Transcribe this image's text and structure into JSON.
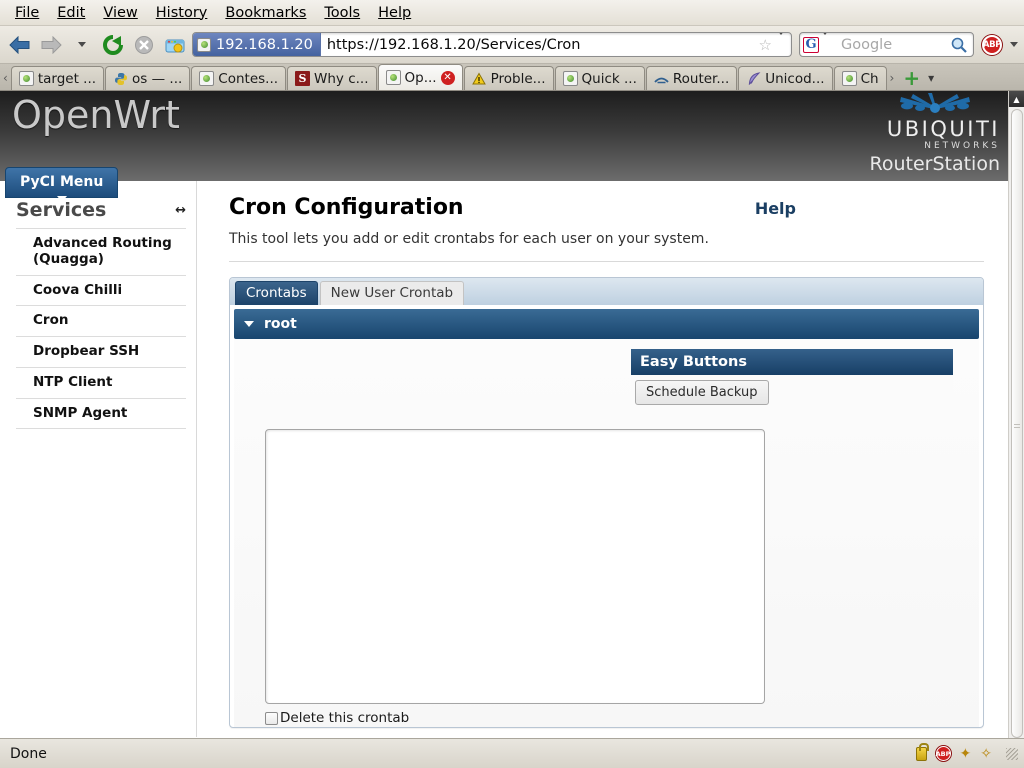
{
  "browser": {
    "menus": [
      "File",
      "Edit",
      "View",
      "History",
      "Bookmarks",
      "Tools",
      "Help"
    ],
    "nav": {
      "back_icon": "back-arrow-icon",
      "forward_icon": "forward-arrow-icon",
      "history_caret_icon": "chevron-down-icon",
      "reload_icon": "reload-icon",
      "stop_icon": "stop-icon",
      "home_icon": "home-icon"
    },
    "address": {
      "identity_label": "192.168.1.20",
      "url": "https://192.168.1.20/Services/Cron",
      "star_icon": "bookmark-star-icon",
      "dropdown_icon": "chevron-down-icon"
    },
    "search": {
      "engine": "G",
      "placeholder": "Google",
      "search_icon": "magnifier-icon"
    },
    "adblock_label": "ABP",
    "tabs": [
      {
        "label": "target ...",
        "icon": "page-icon",
        "active": false
      },
      {
        "label": "os — ...",
        "icon": "python-icon",
        "active": false
      },
      {
        "label": "Contes...",
        "icon": "page-icon",
        "active": false
      },
      {
        "label": "Why c...",
        "icon": "stackoverflow-icon",
        "active": false
      },
      {
        "label": "Op...",
        "icon": "page-icon",
        "active": true
      },
      {
        "label": "Proble...",
        "icon": "warning-icon",
        "active": false
      },
      {
        "label": "Quick ...",
        "icon": "page-icon",
        "active": false
      },
      {
        "label": "Router...",
        "icon": "router-icon",
        "active": false
      },
      {
        "label": "Unicod...",
        "icon": "feather-icon",
        "active": false
      },
      {
        "label": "Ch",
        "icon": "page-icon",
        "active": false
      }
    ],
    "tab_scroll_left_icon": "chevron-left-icon",
    "tab_scroll_right_icon": "chevron-right-icon",
    "new_tab_label": "+",
    "list_tabs_icon": "chevron-down-icon",
    "status": {
      "text": "Done",
      "icons": [
        "lock-icon",
        "adblock-icon",
        "noscript-icon",
        "addon-icon"
      ]
    }
  },
  "page": {
    "brand": "OpenWrt",
    "vendor": {
      "name": "UBIQUITI",
      "sub": "NETWORKS",
      "product": "RouterStation"
    },
    "menu_button": "PyCI Menu",
    "sidebar": {
      "title": "Services",
      "collapse_icon": "collapse-arrows-icon",
      "items": [
        {
          "label": "Advanced Routing (Quagga)"
        },
        {
          "label": "Coova Chilli"
        },
        {
          "label": "Cron"
        },
        {
          "label": "Dropbear SSH"
        },
        {
          "label": "NTP Client"
        },
        {
          "label": "SNMP Agent"
        }
      ]
    },
    "main": {
      "title": "Cron Configuration",
      "help_label": "Help",
      "description": "This tool lets you add or edit crontabs for each user on your system.",
      "tabs": [
        {
          "label": "Crontabs",
          "active": true
        },
        {
          "label": "New User Crontab",
          "active": false
        }
      ],
      "accordion": {
        "label": "root",
        "caret_icon": "triangle-down-icon"
      },
      "easy_buttons": {
        "title": "Easy Buttons",
        "buttons": [
          {
            "label": "Schedule Backup"
          }
        ]
      },
      "crontab_textarea": {
        "value": "",
        "placeholder": ""
      },
      "delete_checkbox": {
        "label": "Delete this crontab",
        "checked": false
      }
    }
  },
  "colors": {
    "accent_blue": "#1d4369",
    "panel_border": "#b9c6d4",
    "header_dark": "#1d1d1d",
    "alert_red": "#cf2020"
  }
}
